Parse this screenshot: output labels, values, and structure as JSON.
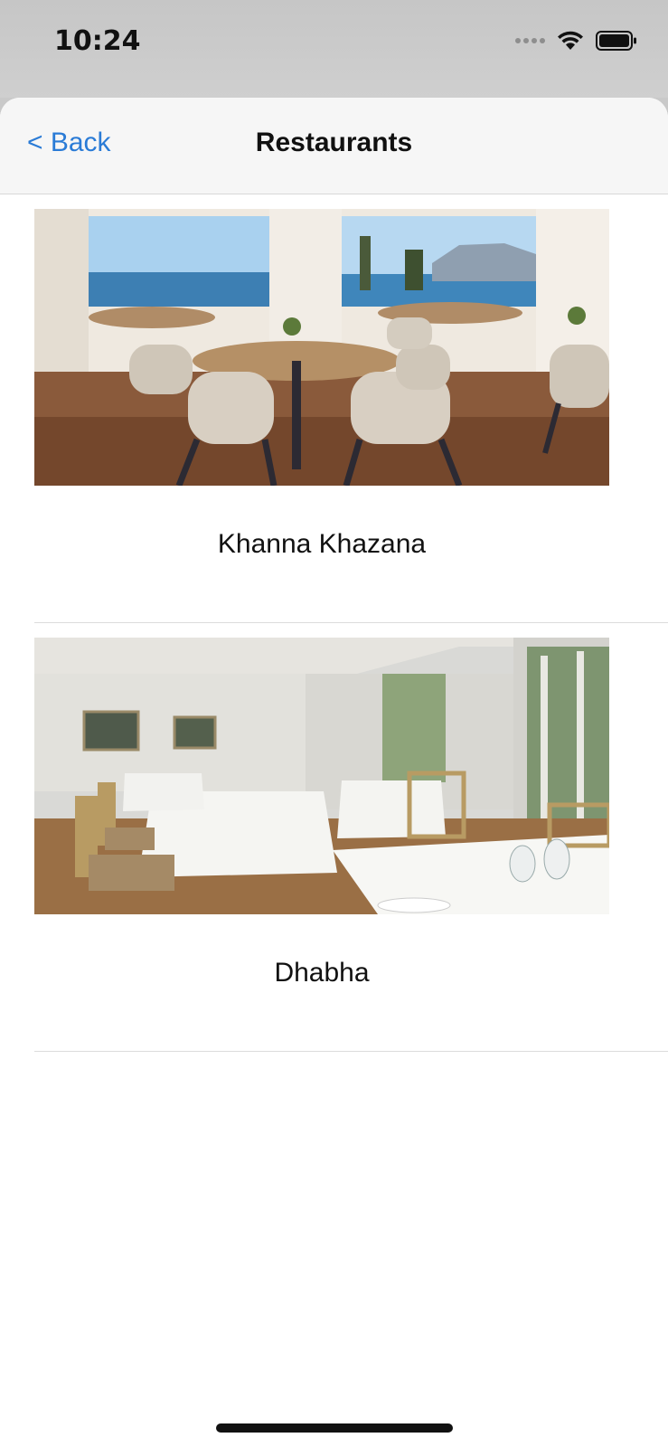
{
  "status_bar": {
    "time": "10:24",
    "icons": [
      "signal-icon",
      "wifi-icon",
      "battery-icon"
    ]
  },
  "nav": {
    "back_label": "< Back",
    "title": "Restaurants"
  },
  "restaurants": [
    {
      "name": "Khanna Khazana",
      "image": "restaurant-photo-sea-view-dining-room"
    },
    {
      "name": "Dhabha",
      "image": "restaurant-photo-white-tablecloth-dining-room"
    }
  ],
  "colors": {
    "accent": "#2a7bd6",
    "nav_background": "#f6f6f6",
    "separator": "#dcdcdc"
  }
}
